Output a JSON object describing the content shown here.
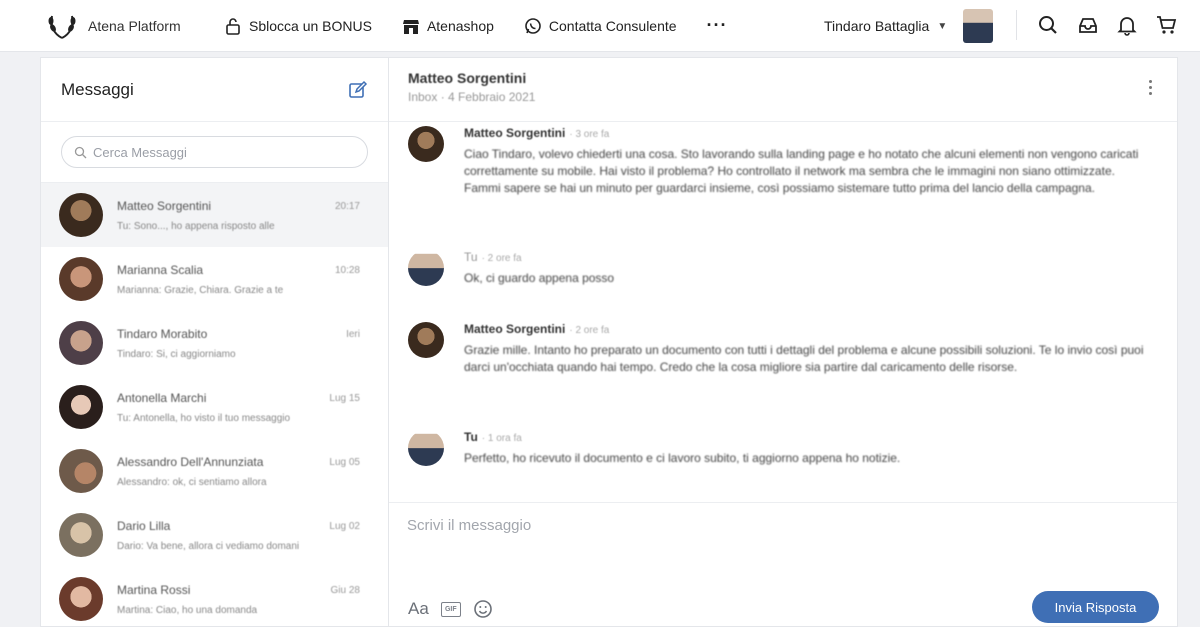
{
  "brand": {
    "name": "Atena Platform",
    "logo_icon": "laurel-logo-icon"
  },
  "nav": {
    "items": [
      {
        "label": "Sblocca un BONUS",
        "icon": "lock-icon"
      },
      {
        "label": "Atenashop",
        "icon": "shop-icon"
      },
      {
        "label": "Contatta Consulente",
        "icon": "whatsapp-icon"
      }
    ],
    "more": "···"
  },
  "user": {
    "name": "Tindaro Battaglia"
  },
  "toolbar_icons": [
    "search-icon",
    "inbox-icon",
    "bell-icon",
    "cart-icon"
  ],
  "messages_panel": {
    "title": "Messaggi",
    "search_placeholder": "Cerca Messaggi",
    "conversations": [
      {
        "name": "Matteo Sorgentini",
        "preview": "Tu: Sono..., ho appena risposto alle",
        "date": "20:17",
        "active": true
      },
      {
        "name": "Marianna Scalia",
        "preview": "Marianna: Grazie, Chiara. Grazie a te",
        "date": "10:28"
      },
      {
        "name": "Tindaro Morabito",
        "preview": "Tindaro: Si, ci aggiorniamo",
        "date": "Ieri"
      },
      {
        "name": "Antonella Marchi",
        "preview": "Tu: Antonella, ho visto il tuo messaggio",
        "date": "Lug 15"
      },
      {
        "name": "Alessandro Dell'Annunziata",
        "preview": "Alessandro: ok, ci sentiamo allora",
        "date": "Lug 05"
      },
      {
        "name": "Dario Lilla",
        "preview": "Dario: Va bene, allora ci vediamo domani",
        "date": "Lug 02"
      },
      {
        "name": "Martina Rossi",
        "preview": "Martina: Ciao, ho una domanda",
        "date": "Giu 28"
      }
    ]
  },
  "chat": {
    "title": "Matteo Sorgentini",
    "subtitle": "Inbox · 4 Febbraio 2021",
    "messages": [
      {
        "author": "Matteo Sorgentini",
        "time": "· 3 ore fa",
        "text": "Ciao Tindaro, volevo chiederti una cosa. Sto lavorando sulla landing page e ho notato che alcuni elementi non vengono caricati correttamente su mobile. Hai visto il problema? Ho controllato il network ma sembra che le immagini non siano ottimizzate. Fammi sapere se hai un minuto per guardarci insieme, così possiamo sistemare tutto prima del lancio della campagna.",
        "avatar": "warm"
      },
      {
        "author": "Tu",
        "time": "· 2 ore fa",
        "text": "Ok, ci guardo appena posso",
        "avatar": "suit"
      },
      {
        "author": "Matteo Sorgentini",
        "time": "· 2 ore fa",
        "text": "Grazie mille. Intanto ho preparato un documento con tutti i dettagli del problema e alcune possibili soluzioni. Te lo invio così puoi darci un'occhiata quando hai tempo. Credo che la cosa migliore sia partire dal caricamento delle risorse.",
        "avatar": "warm"
      },
      {
        "author": "Tu",
        "time": "· 1 ora fa",
        "text": "Perfetto, ho ricevuto il documento e ci lavoro subito, ti aggiorno appena ho notizie.",
        "avatar": "suit"
      }
    ]
  },
  "composer": {
    "placeholder": "Scrivi il messaggio",
    "format_label": "Aa",
    "gif_label": "GIF",
    "send_label": "Invia Risposta"
  },
  "colors": {
    "accent": "#3f6fb5"
  }
}
